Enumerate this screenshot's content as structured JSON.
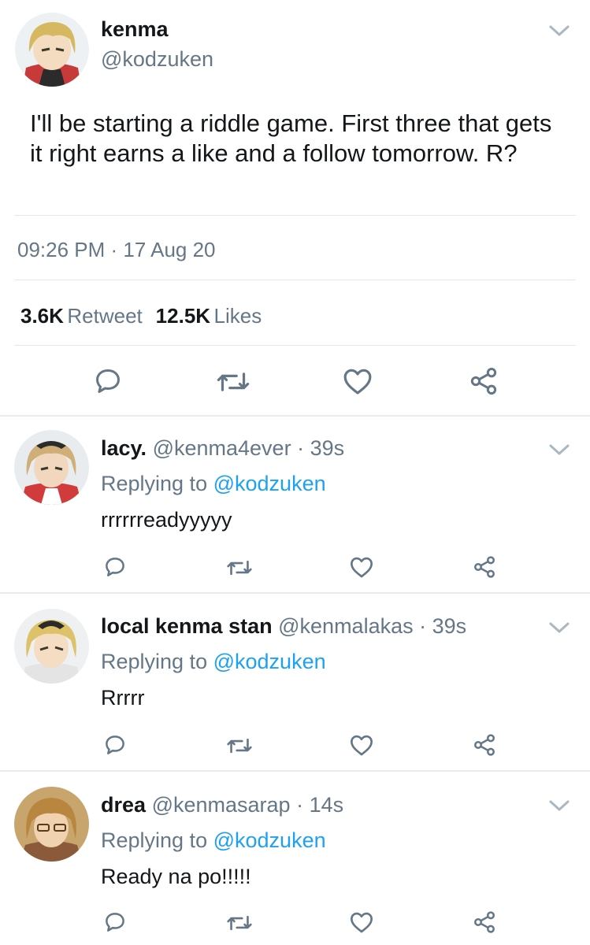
{
  "colors": {
    "link": "#1da1f2",
    "muted": "#657786",
    "text": "#14171a",
    "divider": "#e1e8ed"
  },
  "tweet": {
    "name": "kenma",
    "handle": "@kodzuken",
    "text": "I'll be starting a riddle game. First three that gets it right earns a like and a follow tomorrow. R?",
    "timestamp": "09:26 PM · 17 Aug 20",
    "retweet_count": "3.6K",
    "retweet_label": "Retweet",
    "like_count": "12.5K",
    "like_label": "Likes",
    "actions": [
      "reply-icon",
      "retweet-icon",
      "heart-icon",
      "share-icon"
    ]
  },
  "replies": [
    {
      "name": "lacy.",
      "handle": "@kenma4ever",
      "time": "· 39s",
      "replying_prefix": "Replying to",
      "replying_to": "@kodzuken",
      "text": "rrrrrreadyyyyy"
    },
    {
      "name": "local kenma stan",
      "handle": "@kenmalakas",
      "time": "· 39s",
      "replying_prefix": "Replying to",
      "replying_to": "@kodzuken",
      "text": "Rrrrr"
    },
    {
      "name": "drea",
      "handle": "@kenmasarap",
      "time": "· 14s",
      "replying_prefix": "Replying to",
      "replying_to": "@kodzuken",
      "text": "Ready na po!!!!!"
    }
  ]
}
